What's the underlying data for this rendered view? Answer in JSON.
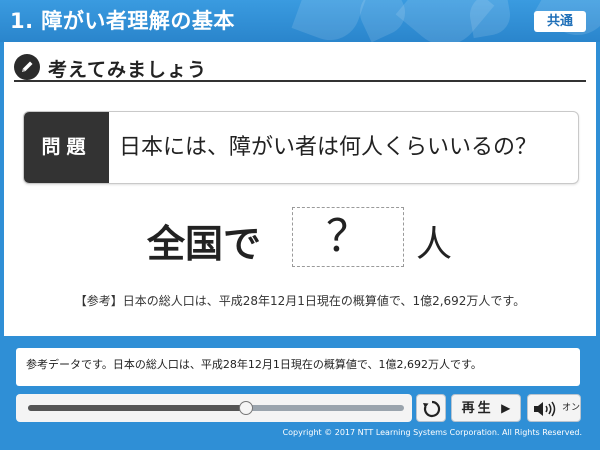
{
  "header": {
    "title": "1. 障がい者理解の基本",
    "badge": "共通"
  },
  "section": {
    "icon": "pencil-icon",
    "title": "考えてみましょう"
  },
  "question": {
    "label": "問題",
    "text": "日本には、障がい者は何人くらいいるの？"
  },
  "answer": {
    "prefix": "全国で",
    "blank": "？",
    "suffix": "人"
  },
  "reference": "【参考】日本の総人口は、平成28年12月1日現在の概算値で、1億2,692万人です。",
  "player": {
    "caption": "参考データです。日本の総人口は、平成28年12月1日現在の概算値で、1億2,692万人です。",
    "progress_fraction": 0.58,
    "rewind_icon": "replay-icon",
    "play_label": "再生",
    "play_icon": "play-triangle-icon",
    "sound_icon": "speaker-icon",
    "sound_label": "オン"
  },
  "copyright": "Copyright © 2017 NTT Learning Systems Corporation. All Rights Reserved.",
  "colors": {
    "header_blue": "#2f8fd6",
    "dark": "#333333"
  }
}
